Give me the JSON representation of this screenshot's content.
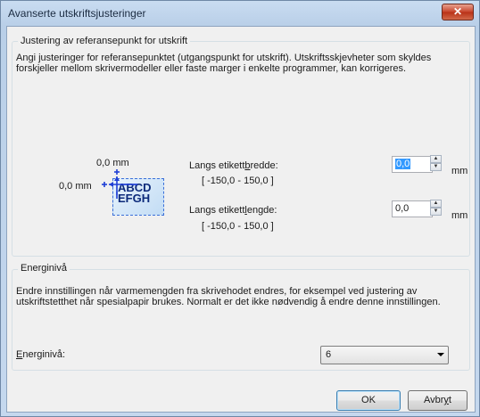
{
  "window": {
    "title": "Avanserte utskriftsjusteringer",
    "close_glyph": "✕"
  },
  "reference": {
    "legend": "Justering av referansepunkt for utskrift",
    "description": "Angi justeringer for referansepunktet (utgangspunkt for utskrift). Utskriftsskjevheter som skyldes forskjeller mellom skrivermodeller eller faste marger i enkelte programmer, kan korrigeres.",
    "diagram": {
      "top_value": "0,0 mm",
      "left_value": "0,0 mm",
      "sample_line1": "ABCD",
      "sample_line2": "EFGH"
    },
    "width": {
      "label_pre": "Langs etikett",
      "label_u": "b",
      "label_post": "redde:",
      "range": "[ -150,0 - 150,0 ]",
      "value": "0,0",
      "unit": "mm"
    },
    "length": {
      "label_pre": "Langs etikett",
      "label_u": "l",
      "label_post": "engde:",
      "range": "[ -150,0 - 150,0 ]",
      "value": "0,0",
      "unit": "mm"
    }
  },
  "energy": {
    "legend": "Energinivå",
    "description": "Endre innstillingen når varmemengden fra skrivehodet endres, for eksempel ved justering av utskriftstetthet når spesialpapir brukes. Normalt er det ikke nødvendig å endre denne innstillingen.",
    "label_u": "E",
    "label_rest": "nerginivå:",
    "value": "6"
  },
  "buttons": {
    "ok": "OK",
    "cancel_pre": "Avbr",
    "cancel_u": "y",
    "cancel_post": "t"
  },
  "colors": {
    "accent": "#3399ff",
    "arrow": "#1f3fd6"
  }
}
